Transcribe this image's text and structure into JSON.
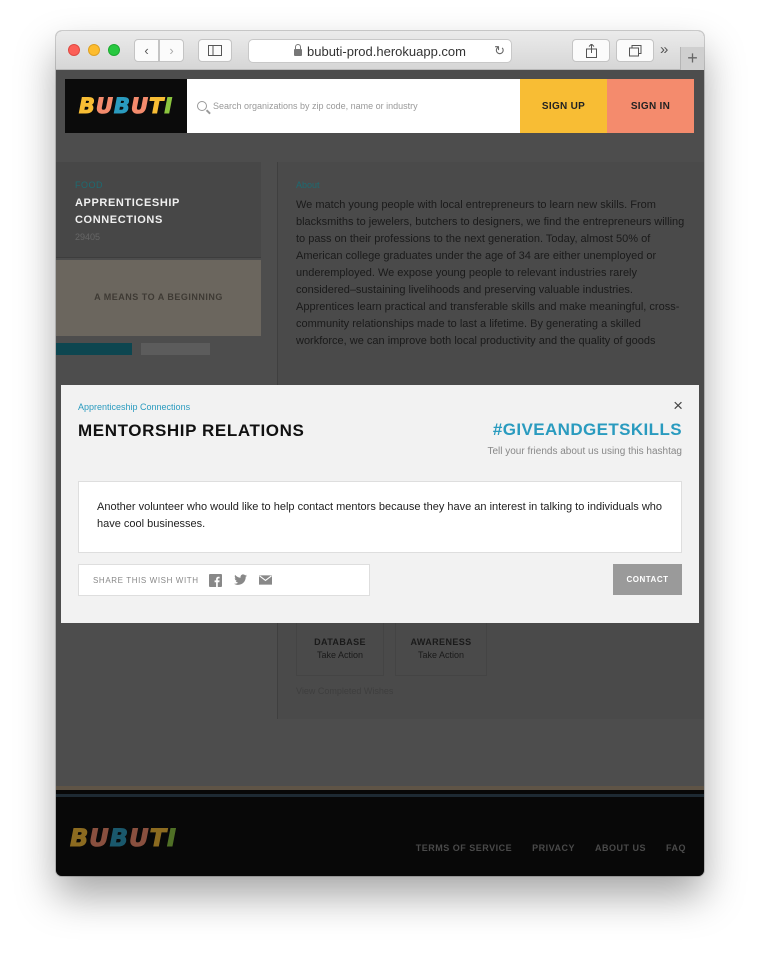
{
  "browser": {
    "url": "bubuti-prod.herokuapp.com",
    "back_glyph": "‹",
    "forward_glyph": "›",
    "more_glyph": "»",
    "newtab_glyph": "+",
    "reload_glyph": "↻"
  },
  "header": {
    "logo_letters": [
      "B",
      "U",
      "B",
      "U",
      "T",
      "I"
    ],
    "search_placeholder": "Search organizations by zip code, name or industry",
    "signup_label": "SIGN UP",
    "signin_label": "SIGN IN"
  },
  "org": {
    "category": "FOOD",
    "name": "APPRENTICESHIP CONNECTIONS",
    "zip": "29405",
    "banner_text": "A MEANS TO A BEGINNING",
    "about_label": "About",
    "about_text": "We match young people with local entrepreneurs to learn new skills. From blacksmiths to jewelers, butchers to designers, we find the entrepreneurs willing to pass on their professions to the next generation. Today, almost 50% of American college graduates under the age of 34 are either unemployed or underemployed. We expose young people to relevant industries rarely considered–sustaining livelihoods and preserving valuable industries. Apprentices learn practical and transferable skills and make meaningful, cross-community relationships made to last a lifetime. By generating a skilled workforce, we can improve both local productivity and the quality of goods",
    "wishes": [
      {
        "title": "DATABASE",
        "action": "Take Action"
      },
      {
        "title": "AWARENESS",
        "action": "Take Action"
      }
    ],
    "view_completed": "View Completed Wishes"
  },
  "footer": {
    "links": [
      "TERMS OF SERVICE",
      "PRIVACY",
      "ABOUT US",
      "FAQ"
    ]
  },
  "modal": {
    "org_name": "Apprenticeship Connections",
    "title": "MENTORSHIP RELATIONS",
    "close_glyph": "×",
    "hashtag": "#GIVEANDGETSKILLS",
    "hashtag_note": "Tell your friends about us using this hashtag",
    "wish_text": "Another volunteer who would like to help contact mentors because they have an interest in talking to individuals who have cool businesses.",
    "share_label": "SHARE THIS WISH WITH",
    "contact_label": "CONTACT"
  },
  "colors": {
    "logo": [
      "#f8bd34",
      "#f48b6d",
      "#2a9bbf",
      "#f48b6d",
      "#f8bd34",
      "#8cc63f"
    ],
    "accent": "#2a9bbf",
    "signup": "#f8bd34",
    "signin": "#f48b6d"
  },
  "icons": [
    "lock-icon",
    "search-icon",
    "close-icon",
    "facebook-icon",
    "twitter-icon",
    "email-icon",
    "share-icon",
    "tabs-icon",
    "sidebar-icon"
  ]
}
